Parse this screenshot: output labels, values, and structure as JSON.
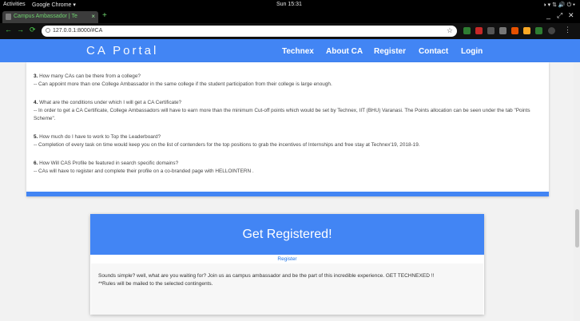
{
  "os": {
    "activities": "Activities",
    "app": "Google Chrome ▾",
    "clock": "Sun 15:31",
    "tray": "◑ ▾  ⇅  🔊  ⏻ ▾"
  },
  "browser": {
    "tab_title": "Campus Ambassador | Te",
    "tab_close": "×",
    "new_tab": "+",
    "url": "127.0.0.1:8000/#CA",
    "back": "←",
    "forward": "→",
    "reload": "⟳",
    "bookmark": "☆",
    "window_min": "_",
    "window_max": "⤢",
    "window_close": "✕"
  },
  "site": {
    "brand": "CA Portal",
    "nav": [
      "Technex",
      "About CA",
      "Register",
      "Contact",
      "Login"
    ]
  },
  "faq": [
    {
      "num": "3.",
      "q": "How many CAs can be there from a college?",
      "a": "-- Can appoint more than one College Ambassador in the same college if the student participation from their college is large enough."
    },
    {
      "num": "4.",
      "q": "What are the conditions under which I will get a CA Certificate?",
      "a": "-- In order to get a CA Certificate, College Ambassadors will have to earn more than the minimum Cut-off points which would be set by Technex, IIT (BHU) Varanasi. The Points allocation can be seen under the tab \"Points Scheme\"."
    },
    {
      "num": "5.",
      "q": "How much do I have to work to Top the Leaderboard?",
      "a": "-- Completion of every task on time would keep you on the list of contenders for the top positions to grab the incentives of Internships and free stay at Technex'19, 2018-19."
    },
    {
      "num": "6.",
      "q": "How Will CAS Profile be featured in search specific domains?",
      "a": "-- CAs will have to register and complete their profile on a co-branded page with HELLOINTERN ."
    }
  ],
  "register": {
    "heading": "Get Registered!",
    "link": "Register",
    "text": "Sounds simple? well, what are you waiting for? Join us as campus ambassador and be the part of this incredible experience. GET TECHNEXED !!",
    "note": "**Rules will be mailed to the selected contingents."
  },
  "colors": {
    "accent": "#4285f4",
    "link": "#1a73e8",
    "tab_text": "#6fd36f"
  }
}
